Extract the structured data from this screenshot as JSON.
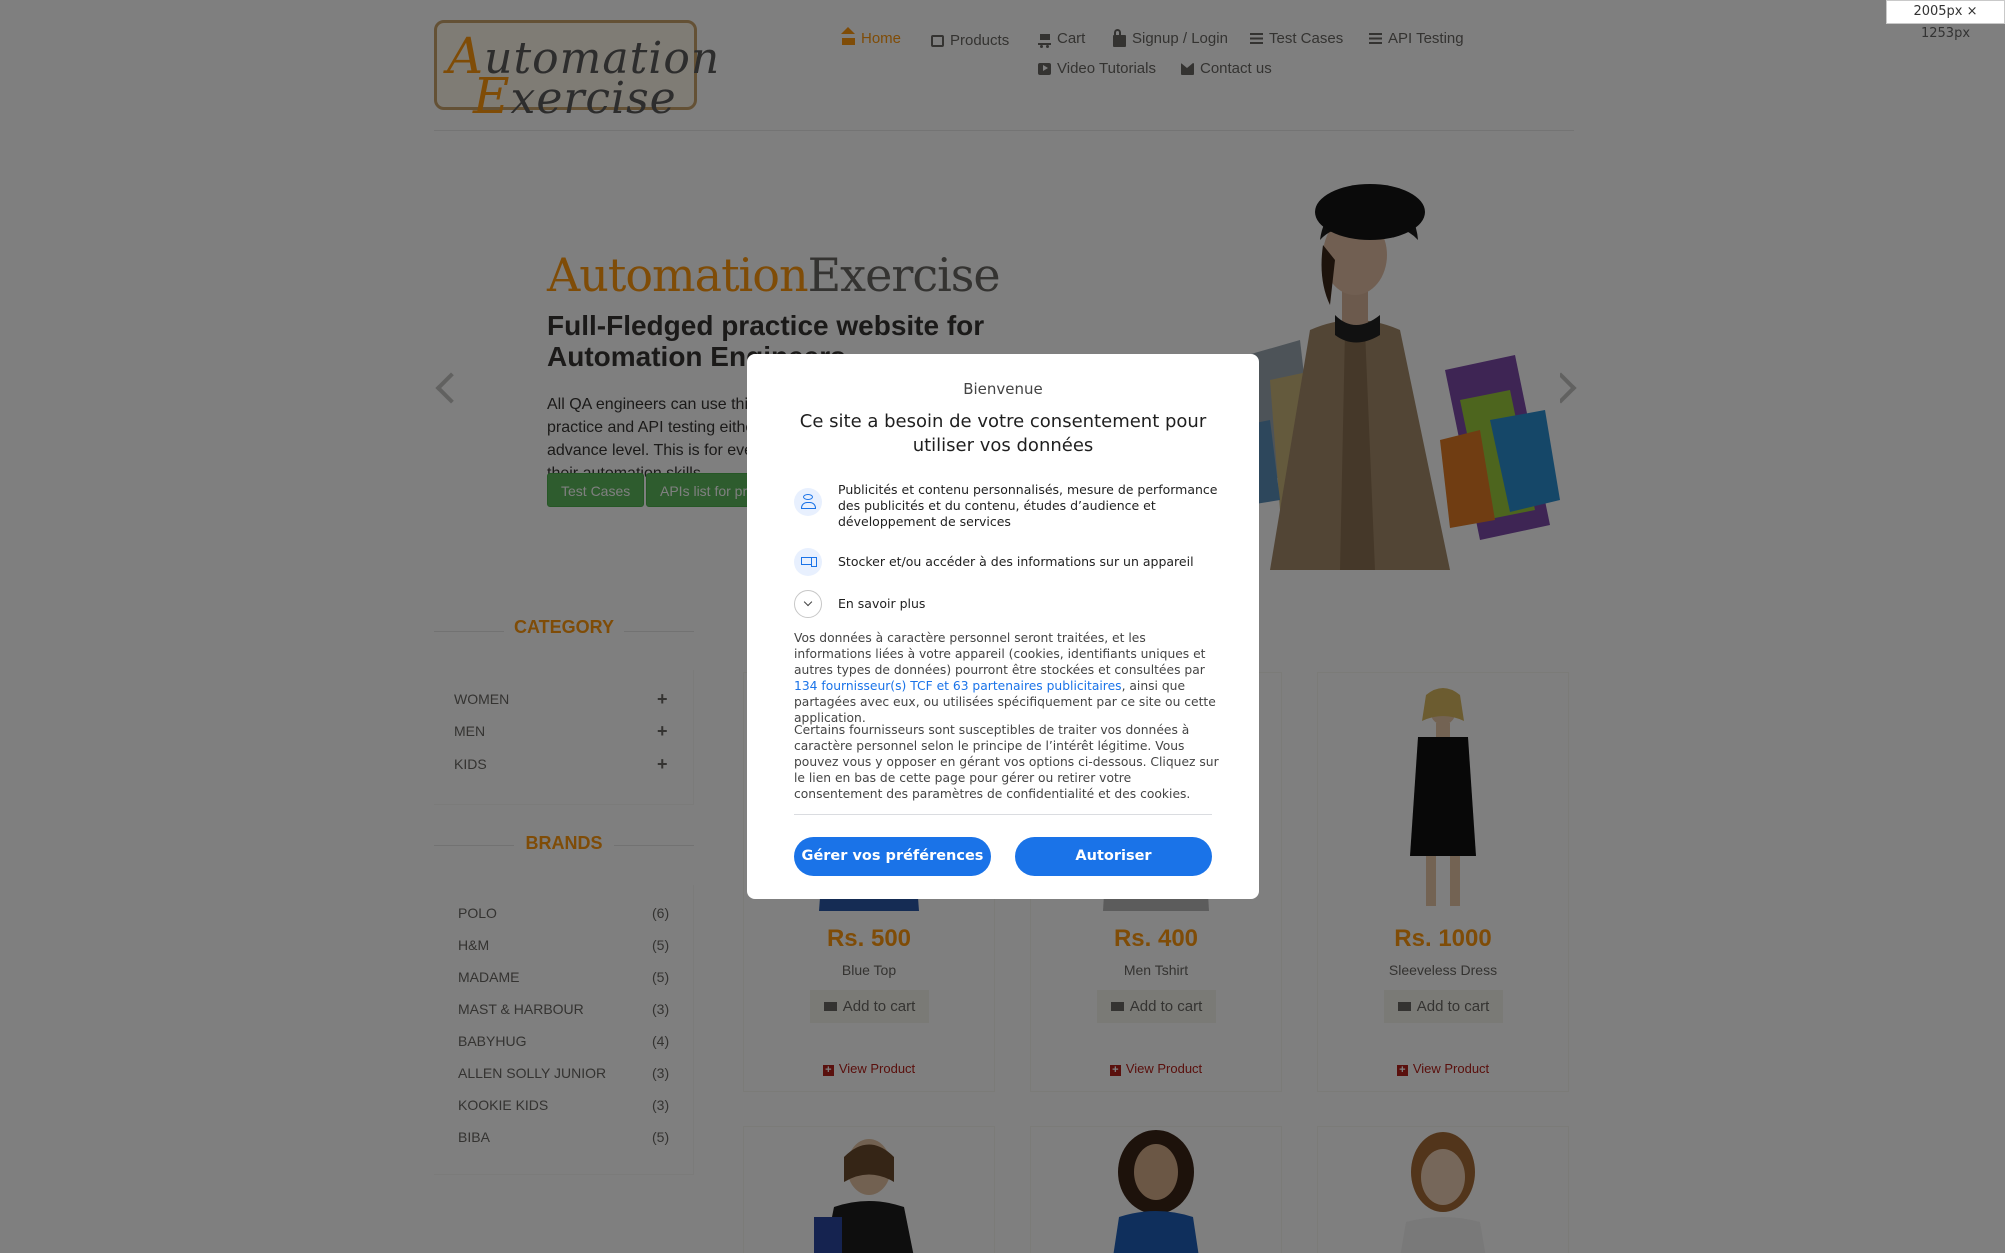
{
  "logo": {
    "line1": "utomation",
    "line1_cap": "A",
    "line2": "xercise",
    "line2_cap": "E"
  },
  "nav": {
    "items": [
      {
        "label": "Home",
        "icon": "home-icon",
        "active": true
      },
      {
        "label": "Products",
        "icon": "products-icon"
      },
      {
        "label": "Cart",
        "icon": "cart-icon"
      },
      {
        "label": "Signup / Login",
        "icon": "lock-icon"
      },
      {
        "label": "Test Cases",
        "icon": "list-icon"
      },
      {
        "label": "API Testing",
        "icon": "list-icon"
      },
      {
        "label": "Video Tutorials",
        "icon": "youtube-icon"
      },
      {
        "label": "Contact us",
        "icon": "envelope-icon"
      }
    ]
  },
  "slider": {
    "title_a": "Automation",
    "title_b": "Exercise",
    "heading": "Full-Fledged practice website for Automation Engineers",
    "text": "All QA engineers can use this website for automation practice and API testing either they are at beginner or advance level. This is for everybody to help them brush up their automation skills.",
    "button_test_cases": "Test Cases",
    "button_apis": "APIs list for practice"
  },
  "sidebar": {
    "category_heading": "CATEGORY",
    "categories": [
      {
        "label": "WOMEN"
      },
      {
        "label": "MEN"
      },
      {
        "label": "KIDS"
      }
    ],
    "plus": "+",
    "brands_heading": "BRANDS",
    "brands": [
      {
        "name": "POLO",
        "count": "(6)"
      },
      {
        "name": "H&M",
        "count": "(5)"
      },
      {
        "name": "MADAME",
        "count": "(5)"
      },
      {
        "name": "MAST & HARBOUR",
        "count": "(3)"
      },
      {
        "name": "BABYHUG",
        "count": "(4)"
      },
      {
        "name": "ALLEN SOLLY JUNIOR",
        "count": "(3)"
      },
      {
        "name": "KOOKIE KIDS",
        "count": "(3)"
      },
      {
        "name": "BIBA",
        "count": "(5)"
      }
    ]
  },
  "products": [
    {
      "price": "Rs. 500",
      "name": "Blue Top",
      "add_label": "Add to cart",
      "view_label": "View Product"
    },
    {
      "price": "Rs. 400",
      "name": "Men Tshirt",
      "add_label": "Add to cart",
      "view_label": "View Product"
    },
    {
      "price": "Rs. 1000",
      "name": "Sleeveless Dress",
      "add_label": "Add to cart",
      "view_label": "View Product"
    }
  ],
  "consent": {
    "welcome": "Bienvenue",
    "title": "Ce site a besoin de votre consentement pour utiliser vos données",
    "purpose_ads": "Publicités et contenu personnalisés, mesure de performance des publicités et du contenu, études d’audience et développement de services",
    "purpose_device": "Stocker et/ou accéder à des informations sur un appareil",
    "learn_more": "En savoir plus",
    "para1_before": "Vos données à caractère personnel seront traitées, et les informations liées à votre appareil (cookies, identifiants uniques et autres types de données) pourront être stockées et consultées par ",
    "para1_link": "134 fournisseur(s) TCF et 63 partenaires publicitaires",
    "para1_after": ", ainsi que partagées avec eux, ou utilisées spécifiquement par ce site ou cette application.",
    "para2": "Certains fournisseurs sont susceptibles de traiter vos données à caractère personnel selon le principe de l’intérêt légitime. Vous pouvez vous y opposer en gérant vos options ci-dessous. Cliquez sur le lien en bas de cette page pour gérer ou retirer votre consentement des paramètres de confidentialité et des cookies.",
    "manage_button": "Gérer vos préférences",
    "accept_button": "Autoriser"
  },
  "size_tag": "2005px × 1253px",
  "colors": {
    "accent": "#fe980f",
    "consent_blue": "#1a73e8",
    "button_green": "#5cb85c",
    "view_red": "#b4201a"
  }
}
